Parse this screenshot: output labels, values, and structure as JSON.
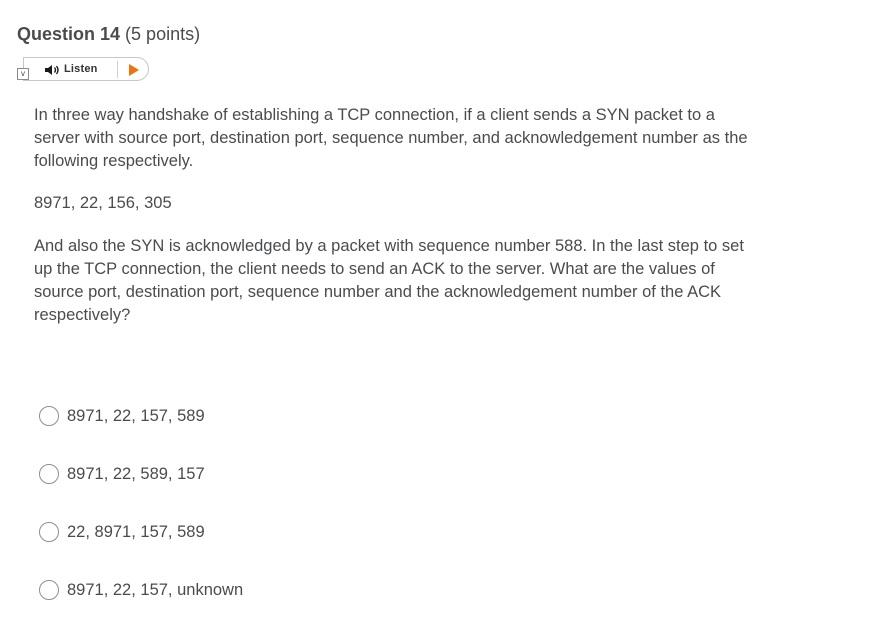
{
  "question": {
    "label": "Question 14",
    "points": "(5 points)"
  },
  "listen": {
    "expand_glyph": "v",
    "label": "Listen",
    "speaker_icon": "speaker-icon",
    "play_icon": "play-icon",
    "play_color": "#e87511"
  },
  "body": {
    "paragraph1": "In three way handshake of establishing a TCP connection, if a client sends a SYN packet to a server with source port, destination port, sequence number, and acknowledgement number as the following respectively.",
    "paragraph2": "8971, 22, 156, 305",
    "paragraph3": "And also the SYN is acknowledged by a packet with sequence number 588. In the last step to set up the TCP connection, the client needs to send an ACK to the server. What are the values of source port, destination port, sequence number and the acknowledgement number of the ACK respectively?"
  },
  "options": [
    {
      "label": "8971, 22, 157, 589",
      "selected": false
    },
    {
      "label": "8971, 22, 589, 157",
      "selected": false
    },
    {
      "label": "22, 8971, 157, 589",
      "selected": false
    },
    {
      "label": "8971, 22, 157, unknown",
      "selected": false
    }
  ]
}
